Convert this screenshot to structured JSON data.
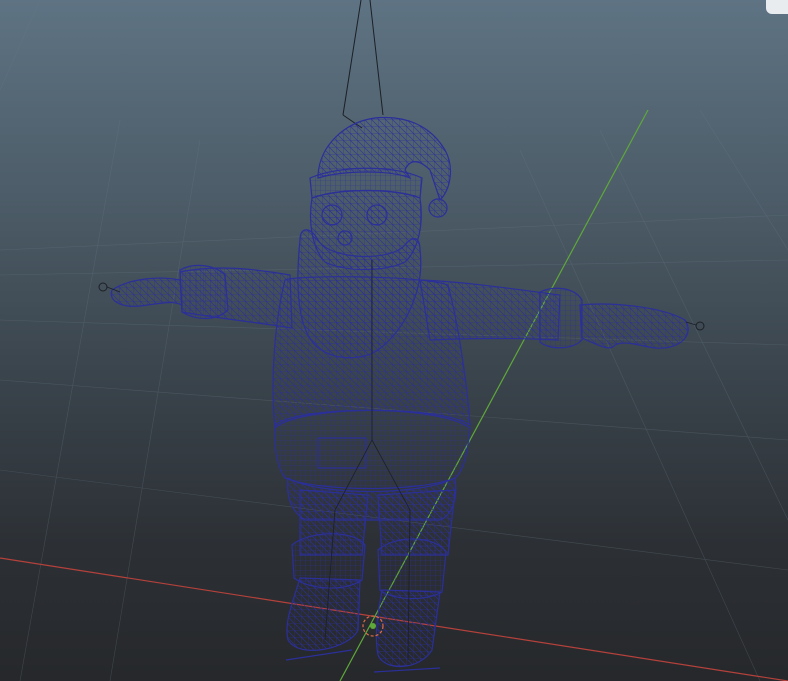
{
  "viewport": {
    "view_cube_label": "",
    "colors": {
      "background_top": "#5e7383",
      "background_bottom": "#26282b",
      "grid_line": "#6a7a86",
      "axis_x": "#b5413b",
      "axis_y": "#5fa83a",
      "wireframe": "#2b2f9a",
      "rig_line": "#1c1f26",
      "pivot": "#e06a4a"
    },
    "model": {
      "name_icon": "santa-wireframe-model",
      "display_mode": "wireframe"
    }
  }
}
